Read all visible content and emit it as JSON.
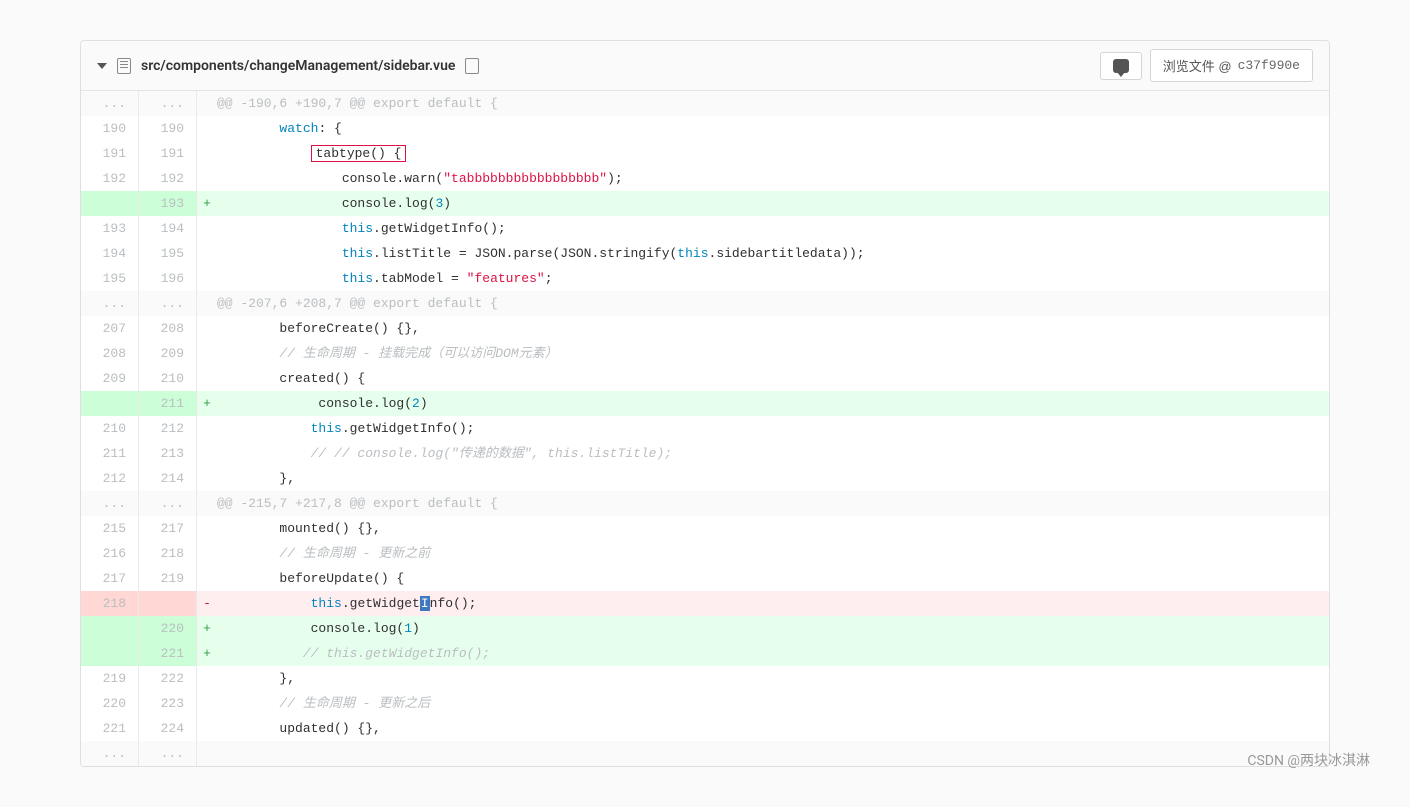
{
  "file_path": "src/components/changeManagement/sidebar.vue",
  "browse_button": "浏览文件 @ ",
  "commit_hash": "c37f990e",
  "watermark": "CSDN @两块冰淇淋",
  "lines": [
    {
      "type": "hunk",
      "old": "...",
      "new": "...",
      "marker": "",
      "html": "@@ -190,6 +190,7 @@ export default {"
    },
    {
      "type": "ctx",
      "old": "190",
      "new": "190",
      "marker": "",
      "html": "        <span class='kw'>watch</span>: {"
    },
    {
      "type": "ctx",
      "old": "191",
      "new": "191",
      "marker": "",
      "html": "            <span class='highlight-box'>tabtype() {</span>"
    },
    {
      "type": "ctx",
      "old": "192",
      "new": "192",
      "marker": "",
      "html": "                console.warn(<span class='str'>\"tabbbbbbbbbbbbbbbbb\"</span>);"
    },
    {
      "type": "added",
      "old": "",
      "new": "193",
      "marker": "+",
      "html": "                console.log(<span class='num'>3</span>)"
    },
    {
      "type": "ctx",
      "old": "193",
      "new": "194",
      "marker": "",
      "html": "                <span class='kw'>this</span>.getWidgetInfo();"
    },
    {
      "type": "ctx",
      "old": "194",
      "new": "195",
      "marker": "",
      "html": "                <span class='kw'>this</span>.listTitle = JSON.parse(JSON.stringify(<span class='kw'>this</span>.sidebartitledata));"
    },
    {
      "type": "ctx",
      "old": "195",
      "new": "196",
      "marker": "",
      "html": "                <span class='kw'>this</span>.tabModel = <span class='str'>\"features\"</span>;"
    },
    {
      "type": "hunk",
      "old": "...",
      "new": "...",
      "marker": "",
      "html": "@@ -207,6 +208,7 @@ export default {"
    },
    {
      "type": "ctx",
      "old": "207",
      "new": "208",
      "marker": "",
      "html": "        beforeCreate() {},"
    },
    {
      "type": "ctx",
      "old": "208",
      "new": "209",
      "marker": "",
      "html": "        <span class='comment'>// 生命周期 - 挂载完成（可以访问DOM元素）</span>"
    },
    {
      "type": "ctx",
      "old": "209",
      "new": "210",
      "marker": "",
      "html": "        created() {"
    },
    {
      "type": "added",
      "old": "",
      "new": "211",
      "marker": "+",
      "html": "             console.log(<span class='num'>2</span>)"
    },
    {
      "type": "ctx",
      "old": "210",
      "new": "212",
      "marker": "",
      "html": "            <span class='kw'>this</span>.getWidgetInfo();"
    },
    {
      "type": "ctx",
      "old": "211",
      "new": "213",
      "marker": "",
      "html": "            <span class='comment'>// // console.log(\"传递的数据\", this.listTitle);</span>"
    },
    {
      "type": "ctx",
      "old": "212",
      "new": "214",
      "marker": "",
      "html": "        },"
    },
    {
      "type": "hunk",
      "old": "...",
      "new": "...",
      "marker": "",
      "html": "@@ -215,7 +217,8 @@ export default {"
    },
    {
      "type": "ctx",
      "old": "215",
      "new": "217",
      "marker": "",
      "html": "        mounted() {},"
    },
    {
      "type": "ctx",
      "old": "216",
      "new": "218",
      "marker": "",
      "html": "        <span class='comment'>// 生命周期 - 更新之前</span>"
    },
    {
      "type": "ctx",
      "old": "217",
      "new": "219",
      "marker": "",
      "html": "        beforeUpdate() {"
    },
    {
      "type": "removed",
      "old": "218",
      "new": "",
      "marker": "-",
      "html": "            <span class='kw'>this</span>.getWidget<span class='text-cursor'>I</span>nfo();"
    },
    {
      "type": "added",
      "old": "",
      "new": "220",
      "marker": "+",
      "html": "            console.log(<span class='num'>1</span>)"
    },
    {
      "type": "added",
      "old": "",
      "new": "221",
      "marker": "+",
      "html": "           <span class='comment'>// this.getWidgetInfo();</span>"
    },
    {
      "type": "ctx",
      "old": "219",
      "new": "222",
      "marker": "",
      "html": "        },"
    },
    {
      "type": "ctx",
      "old": "220",
      "new": "223",
      "marker": "",
      "html": "        <span class='comment'>// 生命周期 - 更新之后</span>"
    },
    {
      "type": "ctx",
      "old": "221",
      "new": "224",
      "marker": "",
      "html": "        updated() {},"
    },
    {
      "type": "hunk",
      "old": "...",
      "new": "...",
      "marker": "",
      "html": " "
    }
  ]
}
